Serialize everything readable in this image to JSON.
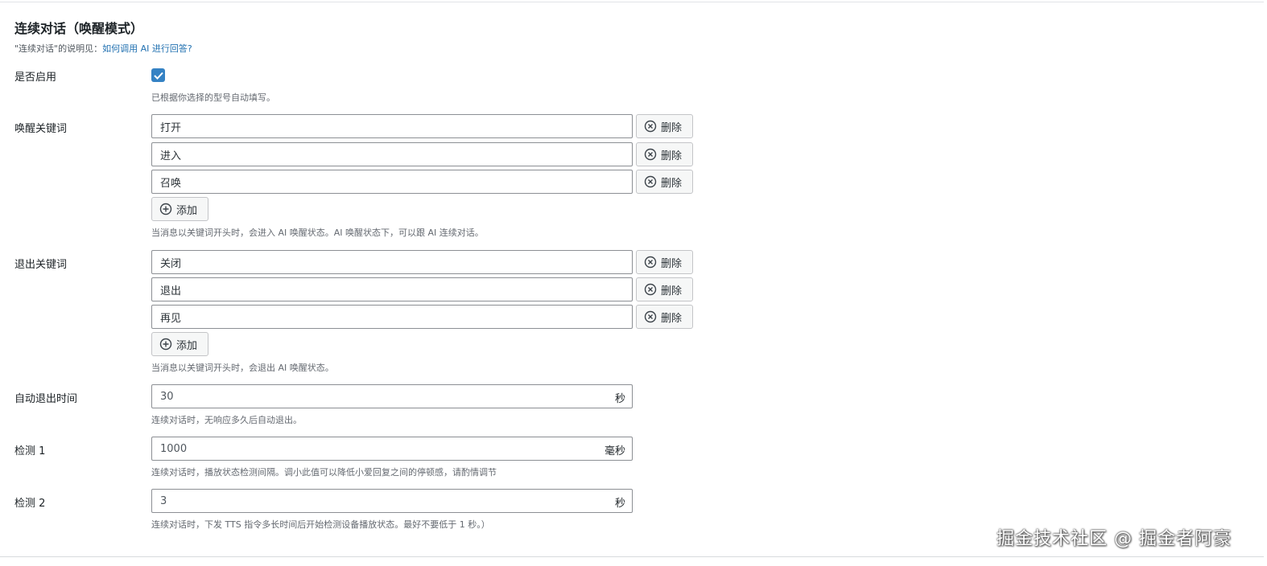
{
  "section": {
    "title": "连续对话（唤醒模式）",
    "desc_prefix": "\"连续对话\"的说明见：",
    "desc_link": "如何调用 AI 进行回答?"
  },
  "enable": {
    "label": "是否启用",
    "checked": true,
    "help": "已根据你选择的型号自动填写。"
  },
  "wake": {
    "label": "唤醒关键词",
    "items": [
      "打开",
      "进入",
      "召唤"
    ],
    "delete_label": "删除",
    "add_label": "添加",
    "help": "当消息以关键词开头时，会进入 AI 唤醒状态。AI 唤醒状态下，可以跟 AI 连续对话。"
  },
  "exit": {
    "label": "退出关键词",
    "items": [
      "关闭",
      "退出",
      "再见"
    ],
    "delete_label": "删除",
    "add_label": "添加",
    "help": "当消息以关键词开头时，会退出 AI 唤醒状态。"
  },
  "auto_exit": {
    "label": "自动退出时间",
    "value": "30",
    "unit": "秒",
    "help": "连续对话时，无响应多久后自动退出。"
  },
  "detect1": {
    "label": "检测 1",
    "value": "1000",
    "unit": "毫秒",
    "help": "连续对话时，播放状态检测间隔。调小此值可以降低小爱回复之间的停顿感，请酌情调节"
  },
  "detect2": {
    "label": "检测 2",
    "value": "3",
    "unit": "秒",
    "help": "连续对话时，下发 TTS 指令多长时间后开始检测设备播放状态。最好不要低于 1 秒。）"
  },
  "watermark": "掘金技术社区 @ 掘金者阿豪",
  "colors": {
    "accent": "#3582c4",
    "link": "#2271b1",
    "border": "#8c8f94"
  }
}
